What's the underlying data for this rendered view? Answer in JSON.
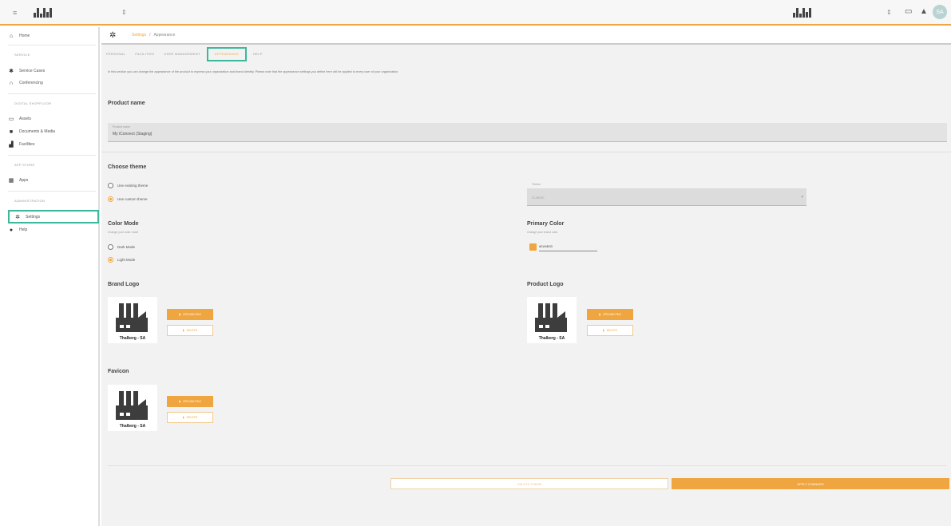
{
  "topbar": {
    "menu_icon": "≡",
    "selector_left": "⇕",
    "selector_right": "⇕",
    "avatar_initials": "SA"
  },
  "sidebar": {
    "home": "Home",
    "section_service": "SERVICE",
    "service_cases": "Service Cases",
    "conferencing": "Conferencing",
    "section_digital": "DIGITAL SHOPFLOOR",
    "assets": "Assets",
    "documents": "Documents & Media",
    "facilities": "Facilities",
    "section_appstore": "APP STORE",
    "apps": "Apps",
    "section_admin": "ADMINISTRATION",
    "settings": "Settings",
    "help": "Help"
  },
  "breadcrumb": {
    "crumb1": "Settings",
    "sep": "/",
    "crumb2": "Appearance"
  },
  "tabs": [
    "PERSONAL",
    "FACILITIES",
    "USER MANAGEMENT",
    "APPEARANCE",
    "HELP"
  ],
  "intro": "In this section you can change the appearance of the product to express your organization and brand identity. Please note that the appearance settings you define here will be applied to every user of your organization.",
  "product_name": {
    "title": "Product name",
    "label": "Product name",
    "value": "My iConnect (Staging)"
  },
  "theme": {
    "title": "Choose theme",
    "option_existing": "Use existing theme",
    "option_custom": "Use custom theme",
    "select_label": "Theme",
    "select_value": "Custom"
  },
  "color_mode": {
    "title": "Color Mode",
    "subtitle": "Change your color mode",
    "dark": "Dark Mode",
    "light": "Light Mode"
  },
  "primary_color": {
    "title": "Primary Color",
    "subtitle": "Change your brand color",
    "value": "#EA9B33",
    "swatch": "#f0a640"
  },
  "brand_logo": {
    "title": "Brand Logo",
    "caption": "Thalberg - SA"
  },
  "product_logo": {
    "title": "Product Logo",
    "caption": "Thalberg - SA"
  },
  "favicon": {
    "title": "Favicon",
    "caption": "Thalberg - SA"
  },
  "buttons": {
    "upload": "UPLOAD FILE",
    "delete": "DELETE",
    "delete_theme": "DELETE THEME",
    "apply": "APPLY CHANGES"
  }
}
